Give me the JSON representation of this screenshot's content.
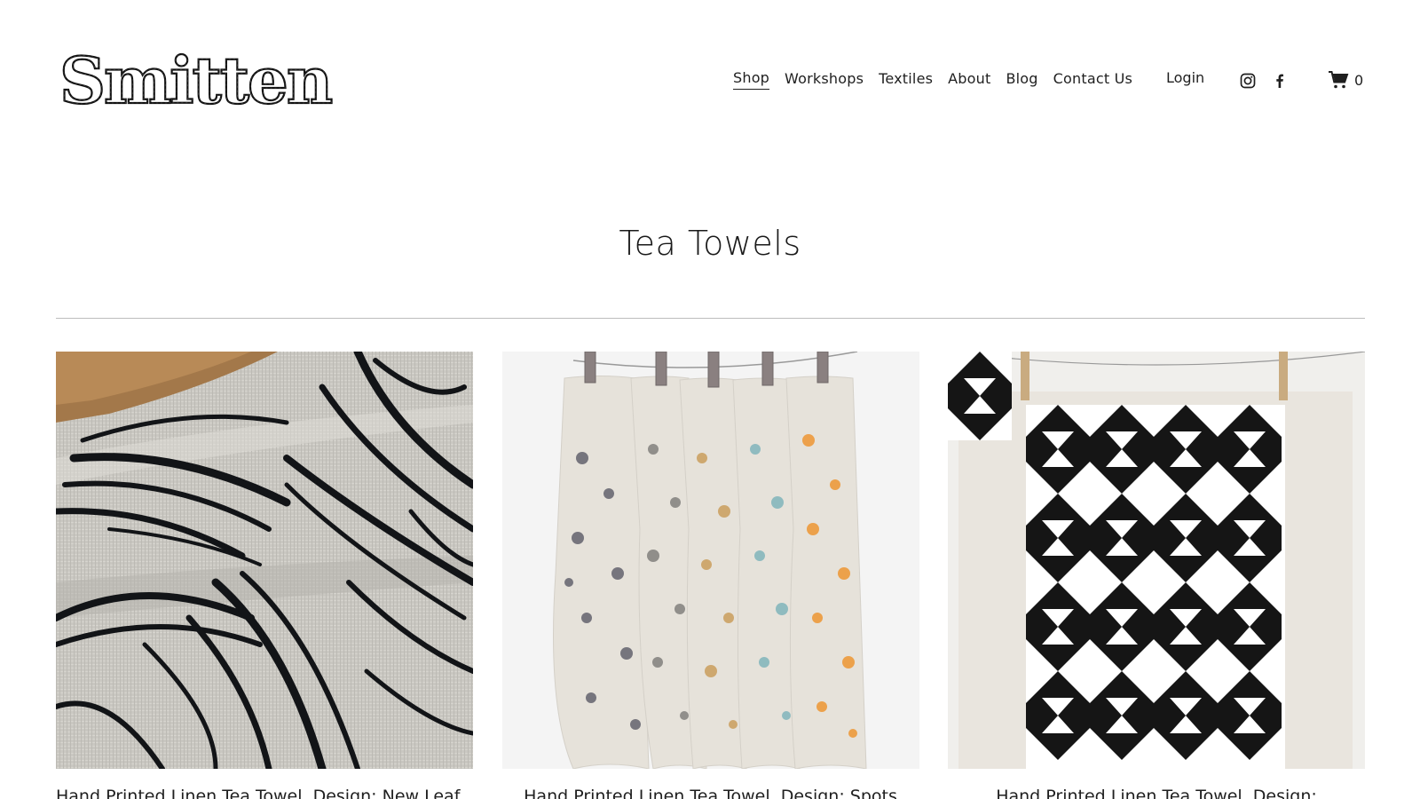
{
  "header": {
    "logo_text": "Smitten",
    "nav": [
      {
        "label": "Shop",
        "active": true
      },
      {
        "label": "Workshops",
        "active": false
      },
      {
        "label": "Textiles",
        "active": false
      },
      {
        "label": "About",
        "active": false
      },
      {
        "label": "Blog",
        "active": false
      },
      {
        "label": "Contact Us",
        "active": false
      }
    ],
    "login_label": "Login",
    "social_icons": [
      "instagram-icon",
      "facebook-icon"
    ],
    "cart_count": "0"
  },
  "page": {
    "title": "Tea Towels"
  },
  "products": [
    {
      "title": "Hand Printed Linen Tea Towel, Design: New Leaf",
      "image": "black-leaf-print-on-grey-linen"
    },
    {
      "title": "Hand Printed Linen Tea Towel, Design: Spots",
      "image": "spotted-linen-towels-on-line"
    },
    {
      "title": "Hand Printed Linen Tea Towel, Design:",
      "image": "black-geometric-triangle-print"
    }
  ]
}
